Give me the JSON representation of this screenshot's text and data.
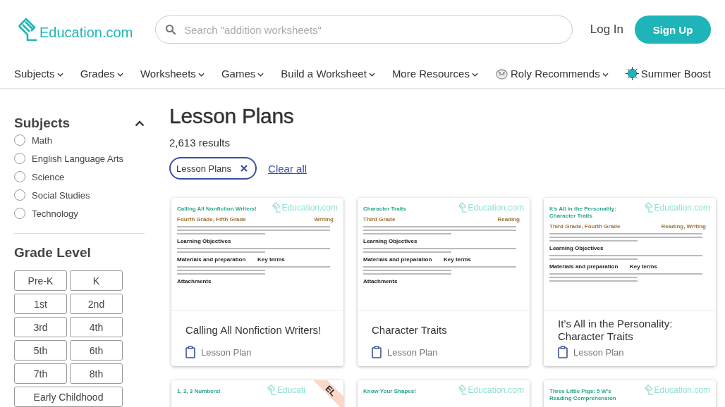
{
  "header": {
    "logo": "Education.com",
    "search": {
      "placeholder": "Search \"addition worksheets\""
    },
    "login": "Log In",
    "signup": "Sign Up"
  },
  "nav": [
    {
      "label": "Subjects",
      "kind": "menu"
    },
    {
      "label": "Grades",
      "kind": "menu"
    },
    {
      "label": "Worksheets",
      "kind": "menu"
    },
    {
      "label": "Games",
      "kind": "menu"
    },
    {
      "label": "Build a Worksheet",
      "kind": "menu"
    },
    {
      "label": "More Resources",
      "kind": "menu"
    },
    {
      "label": "Roly Recommends",
      "kind": "roly"
    },
    {
      "label": "Summer Boost",
      "kind": "sun"
    }
  ],
  "sidebar": {
    "subjects": {
      "title": "Subjects",
      "expanded": true,
      "items": [
        {
          "label": "Math",
          "selected": false
        },
        {
          "label": "English Language Arts",
          "selected": false
        },
        {
          "label": "Science",
          "selected": false
        },
        {
          "label": "Social Studies",
          "selected": false
        },
        {
          "label": "Technology",
          "selected": false
        }
      ]
    },
    "grade_level": {
      "title": "Grade Level",
      "items": [
        {
          "label": "Pre-K",
          "selected": false
        },
        {
          "label": "K",
          "selected": false
        },
        {
          "label": "1st",
          "selected": false
        },
        {
          "label": "2nd",
          "selected": false
        },
        {
          "label": "3rd",
          "selected": false
        },
        {
          "label": "4th",
          "selected": false
        },
        {
          "label": "5th",
          "selected": false
        },
        {
          "label": "6th",
          "selected": false
        },
        {
          "label": "7th",
          "selected": false
        },
        {
          "label": "8th",
          "selected": false
        },
        {
          "label": "Early Childhood",
          "selected": false
        }
      ]
    }
  },
  "main": {
    "title": "Lesson Plans",
    "results": "2,613 results",
    "filters": [
      {
        "label": "Lesson Plans"
      }
    ],
    "clear": "Clear all",
    "cards": [
      {
        "title": "Calling All Nonfiction Writers!",
        "type": "Lesson Plan",
        "thumb": {
          "title": "Calling All Nonfiction Writers!",
          "logo": "Education.com",
          "grades": "Fourth Grade, Fifth Grade",
          "subject": "Writing",
          "headings": [
            "Learning Objectives",
            "Materials and preparation",
            "Attachments"
          ],
          "side_heading": "Key terms"
        }
      },
      {
        "title": "Character Traits",
        "type": "Lesson Plan",
        "thumb": {
          "title": "Character Traits",
          "logo": "Education.com",
          "grades": "Third Grade",
          "subject": "Reading",
          "headings": [
            "Learning Objectives",
            "Materials and preparation",
            "Attachments"
          ],
          "side_heading": "Key terms"
        }
      },
      {
        "title": "It’s All in the Personality: Character Traits",
        "type": "Lesson Plan",
        "thumb": {
          "title": "It’s All in the Personality: Character Traits",
          "logo": "Education.com",
          "grades": "Third Grade, Fourth Grade",
          "subject": "Reading, Writing",
          "headings": [
            "Learning Objectives",
            "Materials and preparation"
          ],
          "side_heading": "Key terms"
        }
      },
      {
        "thumb": {
          "title": "1, 2, 3 Numbers!",
          "logo": "Educati",
          "ribbon": "EL"
        }
      },
      {
        "thumb": {
          "title": "Know Your Shapes!",
          "logo": "Education.com"
        }
      },
      {
        "thumb": {
          "title": "Three Little Pigs: 5 W's Reading Comprehension",
          "logo": "Education.com"
        }
      }
    ]
  }
}
